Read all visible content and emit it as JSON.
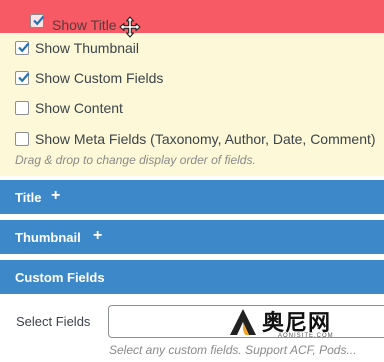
{
  "fields": {
    "dragging": {
      "label": "Show Title",
      "checked": true
    },
    "options": [
      {
        "label": "Show Thumbnail",
        "checked": true
      },
      {
        "label": "Show Custom Fields",
        "checked": true
      },
      {
        "label": "Show Content",
        "checked": false
      },
      {
        "label": "Show Meta Fields (Taxonomy, Author, Date, Comment)",
        "checked": false
      }
    ],
    "hint": "Drag & drop to change display order of fields."
  },
  "sections": [
    {
      "title": "Title",
      "toggle": "+"
    },
    {
      "title": "Thumbnail",
      "toggle": "+"
    },
    {
      "title": "Custom Fields"
    }
  ],
  "custom_fields": {
    "select_label": "Select Fields",
    "input_value": "",
    "description": "Select any custom fields. Support ACF, Pods..."
  },
  "watermark": {
    "text": "奥尼网",
    "subtext": "AONISITE.COM"
  },
  "colors": {
    "drag_highlight": "#f75a64",
    "panel_bg": "#fdf8d7",
    "section_bar": "#3d88c9"
  },
  "icons": {
    "drag": "move-icon",
    "check": "checkmark-icon"
  }
}
